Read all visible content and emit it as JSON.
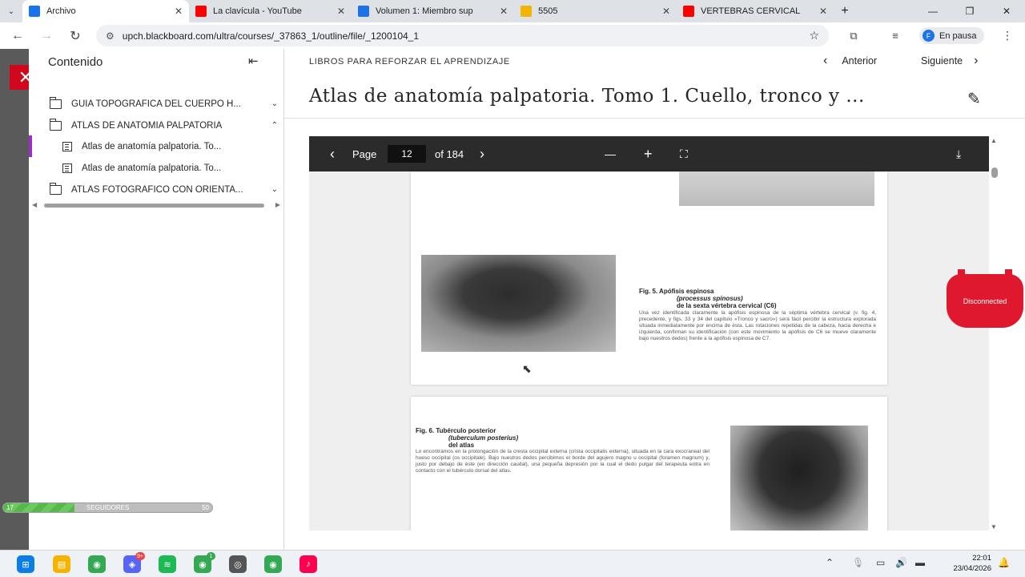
{
  "browser": {
    "tabs": [
      {
        "title": "Archivo",
        "icon": "blackboard-favicon",
        "color": "#1a73e8",
        "active": true
      },
      {
        "title": "La clavícula - YouTube",
        "icon": "youtube-favicon",
        "color": "#ff0000"
      },
      {
        "title": "Volumen 1: Miembro sup",
        "icon": "blackboard-favicon",
        "color": "#1a73e8"
      },
      {
        "title": "5505",
        "icon": "shield-favicon",
        "color": "#f2b400"
      },
      {
        "title": "VERTEBRAS CERVICAL",
        "icon": "youtube-favicon",
        "color": "#ff0000"
      }
    ],
    "new_tab": "+",
    "url": "upch.blackboard.com/ultra/courses/_37863_1/outline/file/_1200104_1",
    "profile_initial": "F",
    "profile_status": "En pausa"
  },
  "toc": {
    "title": "Contenido",
    "items": [
      {
        "label": "GUIA TOPOGRAFICA DEL CUERPO H...",
        "type": "folder",
        "chev": "⌄"
      },
      {
        "label": "ATLAS DE ANATOMIA PALPATORIA",
        "type": "folder",
        "chev": "⌃"
      },
      {
        "label": "Atlas de anatomía palpatoria. To...",
        "type": "doc",
        "selected": true
      },
      {
        "label": "Atlas de anatomía palpatoria. To...",
        "type": "doc"
      },
      {
        "label": "ATLAS FOTOGRAFICO CON ORIENTA...",
        "type": "folder",
        "chev": "⌄"
      }
    ]
  },
  "followers_widget": {
    "current": "17",
    "label": "SEGUIDORES",
    "goal": "50",
    "progress": 0.34
  },
  "content": {
    "section": "LIBROS PARA REFORZAR EL APRENDIZAJE",
    "prev": "Anterior",
    "next": "Siguiente",
    "title": "Atlas de anatomía palpatoria. Tomo 1. Cuello, tronco y ..."
  },
  "viewer": {
    "page_label": "Page",
    "current_page": "12",
    "total": "of 184",
    "zoom_out": "—",
    "zoom_in": "+",
    "fit": "⛶"
  },
  "pdf": {
    "fig5": {
      "title": "Fig. 5.     Apófisis espinosa",
      "latin": "(processus spinosus)",
      "sub": "de la sexta vértebra cervical (C6)",
      "text": "Una vez identificada claramente la apófisis espinosa de la séptima vértebra cervical (v. fig. 4, precedente, y figs. 33 y 34 del capítulo «Tronco y sacro») será fácil percibir la estructura explorada situada inmediatamente por encima de ésta. Las rotaciones repetidas de la cabeza, hacia derecha e izquierda, confirman su identificación (con este movimiento la apófisis de C6 se mueve claramente bajo nuestros dedos) frente a la apófisis espinosa de C7."
    },
    "fig6": {
      "title": "Fig. 6.   Tubérculo posterior",
      "latin": "(tuberculum posterius)",
      "sub": "del atlas",
      "text": "Lo encontramos en la prolongación de la cresta occipital externa (crista occipitalis externa), situada en la cara exocraneal del hueso occipital (os occipitale). Bajo nuestros dedos percibimos el borde del agujero magno u occipital (foramen magnum) y, justo por debajo de éste (en dirección caudal), una pequeña depresión por la cual el dedo pulgar del terapeuta entra en contacto con el tubérculo dorsal del atlas."
    }
  },
  "overlay": {
    "disconnected": "Disconnected"
  },
  "taskbar": {
    "apps": [
      {
        "name": "start",
        "color": "#0a7de6"
      },
      {
        "name": "file-explorer",
        "color": "#f4b400"
      },
      {
        "name": "chrome",
        "color": "#34a853"
      },
      {
        "name": "discord",
        "color": "#5865f2",
        "badge": "9+"
      },
      {
        "name": "spotify",
        "color": "#1db954"
      },
      {
        "name": "chrome-profile",
        "color": "#34a853",
        "badge": "1"
      },
      {
        "name": "obs",
        "color": "#555555"
      },
      {
        "name": "chrome-active",
        "color": "#34a853"
      },
      {
        "name": "tiktok",
        "color": "#ff0050"
      }
    ],
    "time": "22:01",
    "date": "23/04/2026"
  }
}
